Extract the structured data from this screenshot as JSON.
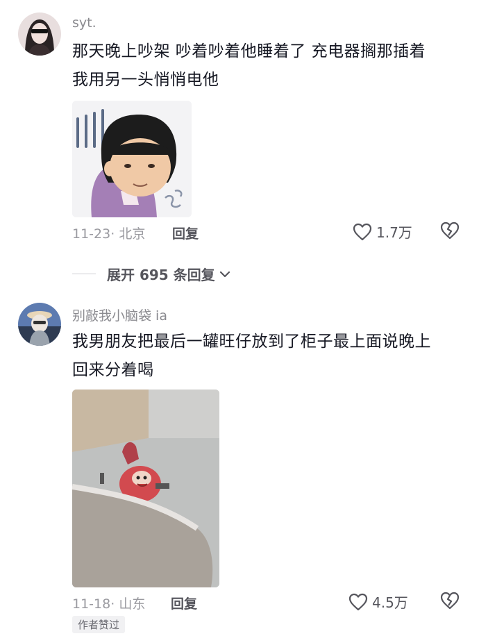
{
  "comments": [
    {
      "username": "syt.",
      "text_line1": "那天晚上吵架  吵着吵着他睡着了  充电器搁那插着",
      "text_line2": "我用另一头悄悄电他",
      "date": "11-23",
      "location": "北京",
      "reply_label": "回复",
      "likes": "1.7万"
    },
    {
      "username": "别敲我小脑袋 ia",
      "text_line1": "我男朋友把最后一罐旺仔放到了柜子最上面说晚上",
      "text_line2": "回来分着喝",
      "date": "11-18",
      "location": "山东",
      "reply_label": "回复",
      "likes": "4.5万",
      "badge": "作者赞过"
    }
  ],
  "expand_replies": "展开 695 条回复",
  "colors": {
    "text": "#161823",
    "meta": "#9a9aa0",
    "username": "#8a8a8f"
  },
  "icons": [
    "heart-icon",
    "broken-heart-icon",
    "chevron-down-icon"
  ]
}
